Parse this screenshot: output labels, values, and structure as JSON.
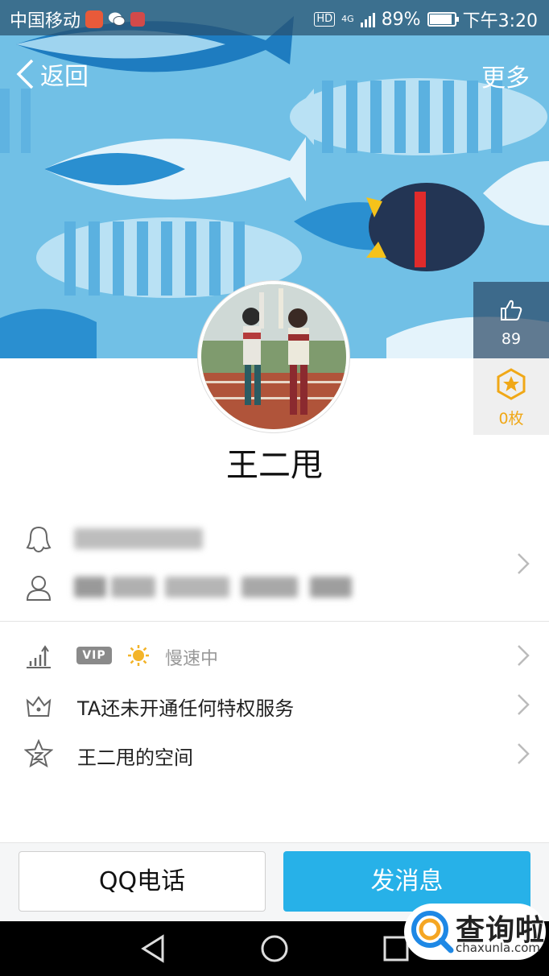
{
  "status_bar": {
    "carrier": "中国移动",
    "network": "4G",
    "battery": "89%",
    "battery_level": 0.89,
    "time": "下午3:20",
    "hd_label": "HD"
  },
  "nav": {
    "back_label": "返回",
    "more_label": "更多"
  },
  "side_panel": {
    "likes_count": "89",
    "badges_count": "0枚"
  },
  "profile": {
    "name": "王二甩"
  },
  "menu": {
    "vip_label": "VIP",
    "level_status": "慢速中",
    "privilege_text": "TA还未开通任何特权服务",
    "space_text": "王二甩的空间"
  },
  "actions": {
    "call_label": "QQ电话",
    "message_label": "发消息"
  },
  "watermark": {
    "title": "查询啦",
    "domain": "chaxunla.com"
  },
  "colors": {
    "accent_blue": "#27b1e8",
    "banner_blue": "#71c0e6",
    "badge_gold": "#f0a817"
  }
}
